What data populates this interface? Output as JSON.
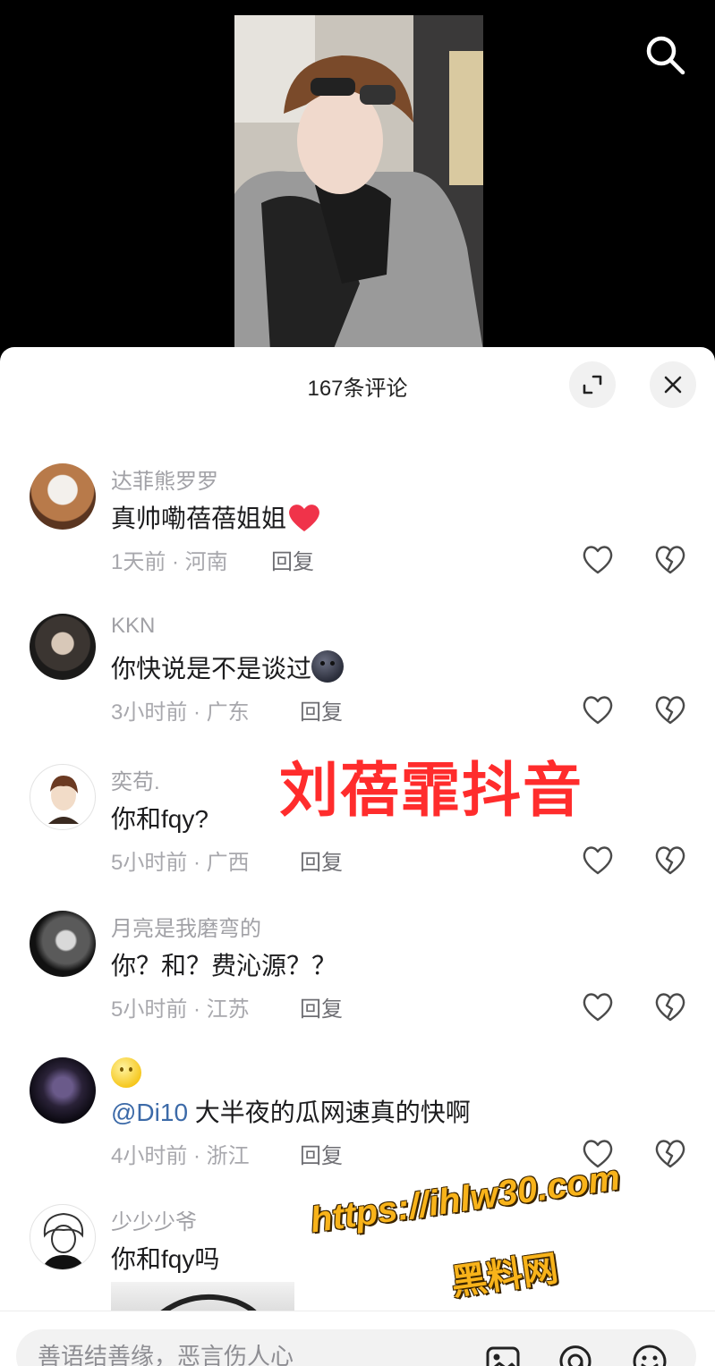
{
  "sheet": {
    "title": "167条评论"
  },
  "comments": [
    {
      "username": "达菲熊罗罗",
      "text": "真帅嘞蓓蓓姐姐",
      "emoji": "heart",
      "meta": "1天前 · 河南",
      "reply_label": "回复"
    },
    {
      "username": "KKN",
      "text": "你快说是不是谈过",
      "emoji": "dark-face",
      "meta": "3小时前 · 广东",
      "reply_label": "回复"
    },
    {
      "username": "奕苟.",
      "text": "你和fqy?",
      "meta": "5小时前 · 广西",
      "reply_label": "回复"
    },
    {
      "username": "月亮是我磨弯的",
      "text": "你？和？费沁源？？",
      "meta": "5小时前 · 江苏",
      "reply_label": "回复"
    },
    {
      "username": "",
      "username_emoji": "smile",
      "mention": "@Di10",
      "text": " 大半夜的瓜网速真的快啊",
      "meta": "4小时前 · 浙江",
      "reply_label": "回复"
    },
    {
      "username": "少少少爷",
      "text": "你和fqy吗"
    }
  ],
  "watermark": {
    "title": "刘蓓霏抖音",
    "url": "https://ihlw30.com",
    "site": "黑料网"
  },
  "input": {
    "placeholder": "善语结善缘，恶言伤人心"
  },
  "colors": {
    "watermark_red": "#ff2c2c",
    "watermark_orange": "#f8b31a",
    "mention_blue": "#3c6aa8"
  },
  "icons": [
    "search-icon",
    "expand-icon",
    "close-icon",
    "like-icon",
    "dislike-icon",
    "image-icon",
    "at-icon",
    "emoji-icon"
  ]
}
